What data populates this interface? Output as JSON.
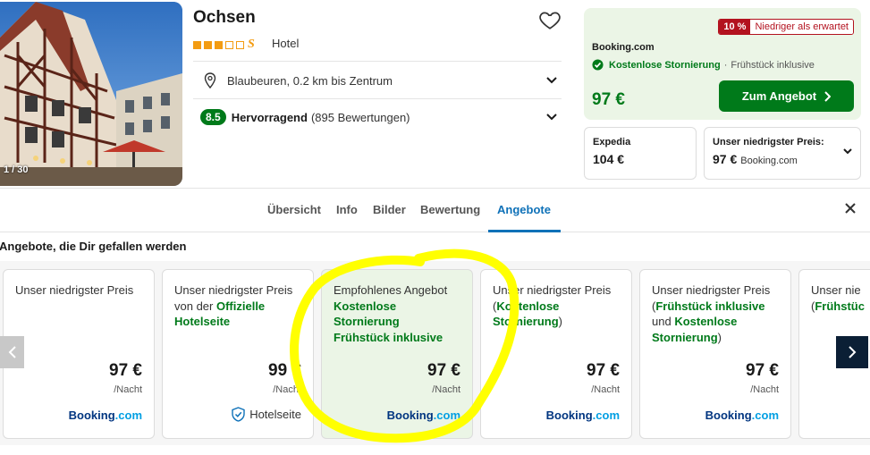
{
  "hotel": {
    "name": "Ochsen",
    "type": "Hotel",
    "stars_filled": 3,
    "stars_total": 5,
    "star_suffix": "S",
    "photo_counter": "1 / 30",
    "location": "Blaubeuren, 0.2 km bis Zentrum",
    "rating_score": "8.5",
    "rating_word": "Hervorragend",
    "rating_count": "(895 Bewertungen)"
  },
  "best_deal": {
    "discount_pct": "10 %",
    "discount_text": "Niedriger als erwartet",
    "provider": "Booking.com",
    "feature_main": "Kostenlose Stornierung",
    "feature_sep": "·",
    "feature_extra": "Frühstück inklusive",
    "price": "97 €",
    "button_label": "Zum Angebot"
  },
  "alt_prices": [
    {
      "label": "Expedia",
      "price": "104 €",
      "provider": ""
    },
    {
      "label": "Unser niedrigster Preis:",
      "price": "97 €",
      "provider": "Booking.com"
    }
  ],
  "tabs": [
    "Übersicht",
    "Info",
    "Bilder",
    "Bewertung",
    "Angebote"
  ],
  "active_tab": "Angebote",
  "offers_title": "Angebote, die Dir gefallen werden",
  "offers": [
    {
      "l1": "Unser niedrigster Preis",
      "price": "97 €",
      "per": "/Nacht",
      "provider_a": "Booking",
      "provider_b": ".com"
    },
    {
      "l1": "Unser niedrigster Preis",
      "l2a": "von der ",
      "l2b": "Offizielle",
      "l3": "Hotelseite",
      "price": "99 €",
      "per": "/Nacht",
      "provider": "Hotelseite"
    },
    {
      "l1": "Empfohlenes Angebot",
      "l2": "Kostenlose",
      "l3": "Stornierung",
      "l4": "Frühstück inklusive",
      "price": "97 €",
      "per": "/Nacht",
      "provider_a": "Booking",
      "provider_b": ".com"
    },
    {
      "l1": "Unser niedrigster Preis",
      "l2a": "(",
      "l2b": "Kostenlose",
      "l3": "Stornierung",
      "l3c": ")",
      "price": "97 €",
      "per": "/Nacht",
      "provider_a": "Booking",
      "provider_b": ".com"
    },
    {
      "l1": "Unser niedrigster Preis",
      "l2a": "(",
      "l2b": "Frühstück inklusive",
      "l3a": "und ",
      "l3b": "Kostenlose",
      "l4": "Stornierung",
      "l4c": ")",
      "price": "97 €",
      "per": "/Nacht",
      "provider_a": "Booking",
      "provider_b": ".com"
    },
    {
      "l1": "Unser nie",
      "l2a": "(",
      "l2b": "Frühstüc"
    }
  ],
  "colors": {
    "green": "#007a1a",
    "deal_bg": "#ebf5e6",
    "tab_active": "#0e71b8",
    "discount_red": "#b3121f",
    "star_orange": "#f39c12",
    "highlight": "#ffff00"
  },
  "icons": [
    "heart-icon",
    "location-pin-icon",
    "chevron-down-icon",
    "check-circle-icon",
    "chevron-right-icon",
    "close-icon",
    "shield-icon",
    "arrow-left-icon",
    "arrow-right-icon"
  ]
}
